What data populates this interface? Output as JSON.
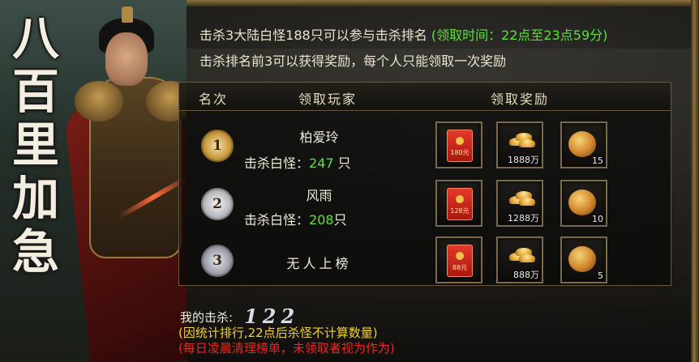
{
  "title_chars": [
    "八",
    "百",
    "里",
    "加",
    "急"
  ],
  "header": {
    "line1_main": "击杀3大陆白怪188只可以参与击杀排名",
    "line1_time": "(领取时间：22点至23点59分)",
    "line2": "击杀排名前3可以获得奖励，每个人只能领取一次奖励"
  },
  "table": {
    "headers": [
      "名次",
      "领取玩家",
      "领取奖励"
    ],
    "kills_label": "击杀白怪：",
    "rows": [
      {
        "rank": "1",
        "player": "柏爱玲",
        "kills": "247",
        "kills_unit": " 只",
        "rewards": [
          {
            "icon": "red-envelope-icon",
            "label": "180元"
          },
          {
            "icon": "gold-ingot-icon",
            "qty": "1888万"
          },
          {
            "icon": "gold-egg-icon",
            "qty": "15"
          }
        ]
      },
      {
        "rank": "2",
        "player": "风雨",
        "kills": "208",
        "kills_unit": "只",
        "rewards": [
          {
            "icon": "red-envelope-icon",
            "label": "128元"
          },
          {
            "icon": "gold-ingot-icon",
            "qty": "1288万"
          },
          {
            "icon": "gold-egg-icon",
            "qty": "10"
          }
        ]
      },
      {
        "rank": "3",
        "player": "无人上榜",
        "rewards": [
          {
            "icon": "red-envelope-icon",
            "label": "88元"
          },
          {
            "icon": "gold-ingot-icon",
            "qty": "888万"
          },
          {
            "icon": "gold-egg-icon",
            "qty": "5"
          }
        ]
      }
    ]
  },
  "footer": {
    "my_kills_label": "我的击杀:",
    "my_kills_value": "122",
    "note_yellow": "(因统计排行,22点后杀怪不计算数量)",
    "note_red": "(每日凌晨清理榜单，未领取者视为作为)"
  },
  "colors": {
    "green": "#5ee03a",
    "yellow": "#f2d12a",
    "red": "#e8281c",
    "gold_border": "#7a6a4a"
  }
}
